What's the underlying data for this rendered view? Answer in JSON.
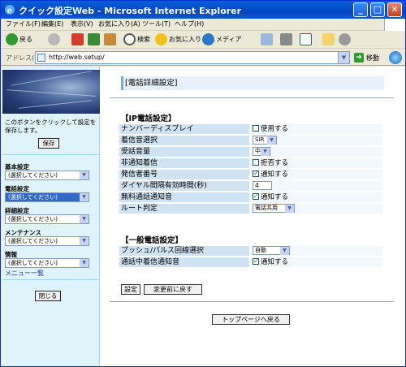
{
  "window": {
    "title": "クイック設定Web - Microsoft Internet Explorer",
    "minimize": "_",
    "maximize": "□",
    "close": "✕"
  },
  "menubar": [
    "ファイル(F)",
    "編集(E)",
    "表示(V)",
    "お気に入り(A)",
    "ツール(T)",
    "ヘルプ(H)"
  ],
  "toolbar": {
    "back": "戻る",
    "search": "検索",
    "favorites": "お気に入り",
    "media": "メディア"
  },
  "address": {
    "label": "アドレス(D)",
    "url": "http://web.setup/",
    "go": "移動"
  },
  "sidebar": {
    "note": "このボタンをクリックして設定を保存します。",
    "save": "保存",
    "groups": [
      {
        "label": "基本設定",
        "value": "(選択してください)",
        "selected": false
      },
      {
        "label": "電話設定",
        "value": "(選択してください)",
        "selected": true
      },
      {
        "label": "詳細設定",
        "value": "(選択してください)",
        "selected": false
      },
      {
        "label": "メンテナンス",
        "value": "(選択してください)",
        "selected": false
      },
      {
        "label": "情報",
        "value": "(選択してください)",
        "selected": false
      }
    ],
    "menu_link": "メニュー一覧",
    "close": "閉じる"
  },
  "main": {
    "page_title": "[電話詳細設定]",
    "ip_section": "【IP電話設定】",
    "ip_rows": [
      {
        "label": "ナンバーディスプレイ",
        "checked": false,
        "text": "使用する"
      },
      {
        "label": "着信音選択",
        "select": "SIR"
      },
      {
        "label": "受話音量",
        "select": "中"
      },
      {
        "label": "非通知着信",
        "checked": false,
        "text": "拒否する"
      },
      {
        "label": "発信者番号",
        "checked": true,
        "text": "通知する"
      },
      {
        "label": "ダイヤル間隔有効時間(秒)",
        "input": "4"
      },
      {
        "label": "無料通話通知音",
        "checked": true,
        "text": "通知する"
      },
      {
        "label": "ルート判定",
        "select": "電話共用"
      }
    ],
    "general_section": "【一般電話設定】",
    "general_rows": [
      {
        "label": "プッシュ/パルス回線選択",
        "select": "自動"
      },
      {
        "label": "通話中着信通知音",
        "checked": true,
        "text": "通知する"
      }
    ],
    "set_button": "設定",
    "revert_button": "変更前に戻す",
    "top_button": "トップページへ戻る"
  }
}
